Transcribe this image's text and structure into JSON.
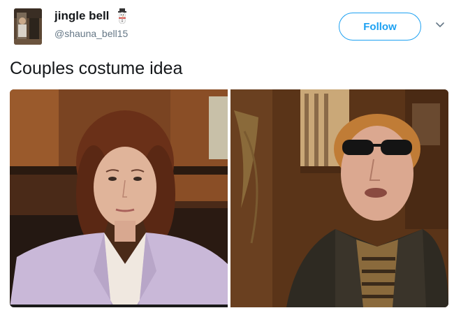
{
  "user": {
    "display_name": "jingle bell",
    "handle": "@shauna_bell15",
    "name_emoji": "snowman-icon",
    "avatar": "avatar"
  },
  "follow": {
    "label": "Follow"
  },
  "menu": {
    "icon": "chevron-down-icon"
  },
  "tweet": {
    "text": "Couples costume idea"
  },
  "media": {
    "photos": [
      {
        "name": "photo-woman-lavender-blazer"
      },
      {
        "name": "photo-man-sunglasses"
      }
    ]
  },
  "colors": {
    "accent": "#1da1f2",
    "handle": "#657786",
    "text": "#14171a"
  }
}
